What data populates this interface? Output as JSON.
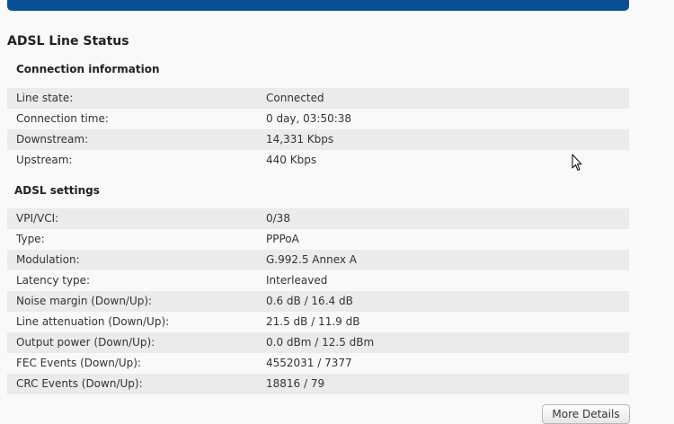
{
  "page_title": "ADSL Line Status",
  "connection": {
    "title": "Connection information",
    "rows": [
      {
        "label": "Line state:",
        "value": "Connected"
      },
      {
        "label": "Connection time:",
        "value": "0 day, 03:50:38"
      },
      {
        "label": "Downstream:",
        "value": "14,331 Kbps"
      },
      {
        "label": "Upstream:",
        "value": "440 Kbps"
      }
    ]
  },
  "adsl": {
    "title": "ADSL settings",
    "rows": [
      {
        "label": "VPI/VCI:",
        "value": "0/38"
      },
      {
        "label": "Type:",
        "value": "PPPoA"
      },
      {
        "label": "Modulation:",
        "value": "G.992.5 Annex A"
      },
      {
        "label": "Latency type:",
        "value": "Interleaved"
      },
      {
        "label": "Noise margin (Down/Up):",
        "value": "0.6 dB / 16.4 dB"
      },
      {
        "label": "Line attenuation (Down/Up):",
        "value": "21.5 dB / 11.9 dB"
      },
      {
        "label": "Output power (Down/Up):",
        "value": "0.0 dBm / 12.5 dBm"
      },
      {
        "label": "FEC Events (Down/Up):",
        "value": "4552031 / 7377"
      },
      {
        "label": "CRC Events (Down/Up):",
        "value": "18816 / 79"
      }
    ]
  },
  "more_details_label": "More Details",
  "colors": {
    "header_bar": "#0a4f96",
    "row_shade": "#ebebeb",
    "background": "#f9f9f9"
  },
  "icons": {
    "cursor": "mouse-pointer-icon"
  }
}
